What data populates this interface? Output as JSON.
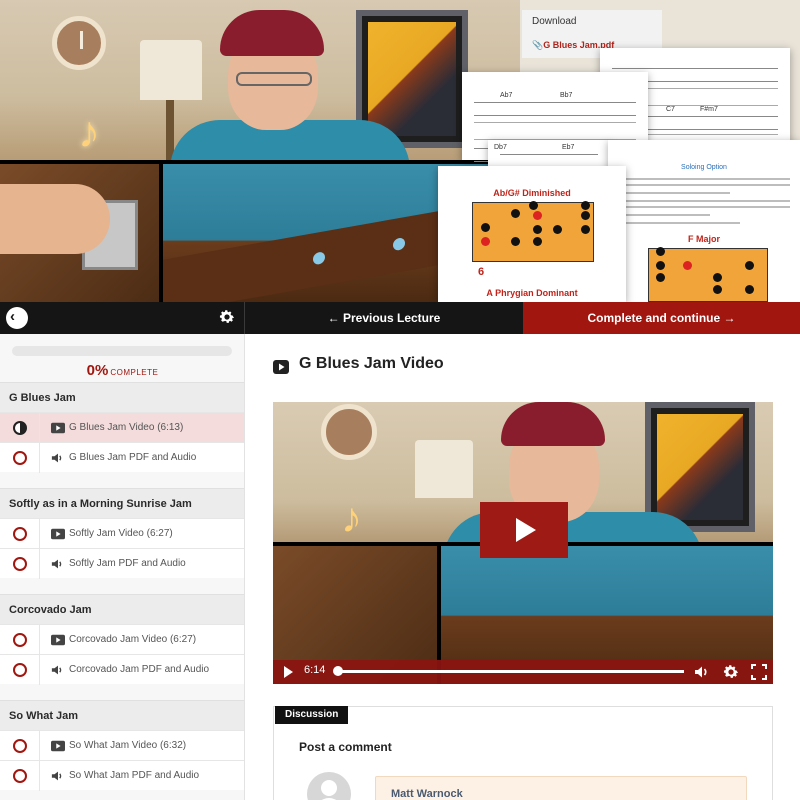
{
  "resources": {
    "download_label": "Download",
    "file_name": "G Blues Jam.pdf",
    "sheet_titles": {
      "diminished": "Ab/G# Diminished",
      "phrygian": "A Phrygian Dominant",
      "soloing": "Soloing Option",
      "fmajor": "F Major"
    },
    "chords": [
      "Ab7",
      "Bb7",
      "C7",
      "F#m7",
      "Db7",
      "Eb7"
    ]
  },
  "nav": {
    "back_icon": "chevron-left-icon",
    "settings_icon": "gear-icon",
    "previous_label": "Previous Lecture",
    "previous_arrow": "←",
    "next_label": "Complete and continue",
    "next_arrow": "→"
  },
  "progress": {
    "percent_value": 0,
    "percent_text": "0%",
    "complete_word": "COMPLETE"
  },
  "sections": [
    {
      "title": "G Blues Jam",
      "lectures": [
        {
          "label": "G Blues Jam Video (6:13)",
          "type": "video",
          "status": "in-progress",
          "active": true
        },
        {
          "label": "G Blues Jam PDF and Audio",
          "type": "audio",
          "status": "incomplete",
          "active": false
        }
      ]
    },
    {
      "title": "Softly as in a Morning Sunrise Jam",
      "lectures": [
        {
          "label": "Softly Jam Video (6:27)",
          "type": "video",
          "status": "incomplete",
          "active": false
        },
        {
          "label": "Softly Jam PDF and Audio",
          "type": "audio",
          "status": "incomplete",
          "active": false
        }
      ]
    },
    {
      "title": "Corcovado Jam",
      "lectures": [
        {
          "label": "Corcovado Jam Video (6:27)",
          "type": "video",
          "status": "incomplete",
          "active": false
        },
        {
          "label": "Corcovado Jam PDF and Audio",
          "type": "audio",
          "status": "incomplete",
          "active": false
        }
      ]
    },
    {
      "title": "So What Jam",
      "lectures": [
        {
          "label": "So What Jam Video (6:32)",
          "type": "video",
          "status": "incomplete",
          "active": false
        },
        {
          "label": "So What Jam PDF and Audio",
          "type": "audio",
          "status": "incomplete",
          "active": false
        }
      ]
    }
  ],
  "main": {
    "title_icon": "youtube-play-icon",
    "title": "G Blues Jam Video",
    "player": {
      "time": "6:14",
      "play_icon": "play-icon",
      "volume_icon": "volume-icon",
      "settings_icon": "gear-icon",
      "fullscreen_icon": "fullscreen-icon"
    }
  },
  "discussion": {
    "tab_label": "Discussion",
    "post_heading": "Post a comment",
    "first_author": "Matt Warnock"
  },
  "colors": {
    "accent": "#a11710",
    "nav_bg": "#151515",
    "active_row": "#f3dcdb",
    "comment_bg": "#fdf1e6"
  }
}
